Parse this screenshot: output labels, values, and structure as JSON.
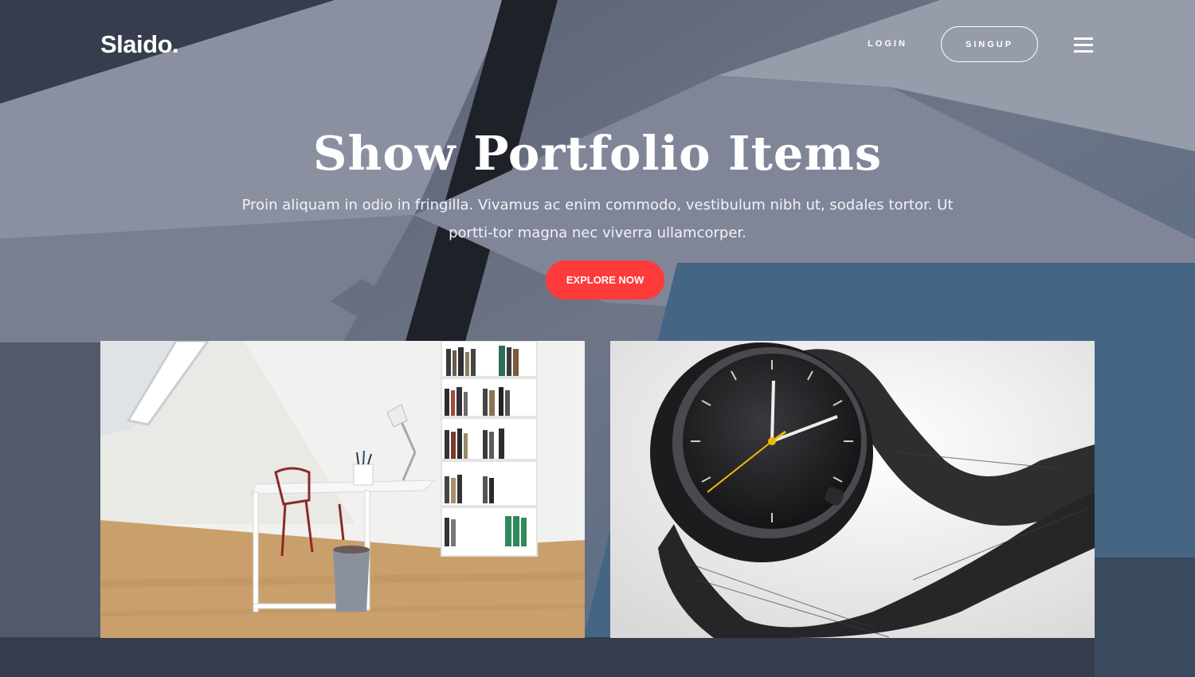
{
  "header": {
    "brand": "Slaido.",
    "login_label": "LOGIN",
    "signup_label": "SINGUP",
    "menu_icon": "hamburger-menu-icon"
  },
  "hero": {
    "title": "Show Portfolio Items",
    "description": "Proin aliquam in odio in fringilla. Vivamus ac enim commodo, vestibulum nibh ut, sodales tortor. Ut portti-tor magna nec viverra ullamcorper.",
    "cta_label": "EXPLORE NOW",
    "background_image": "architectural-frames-photo"
  },
  "portfolio": {
    "items": [
      {
        "image": "white-office-desk-with-bookshelf-photo"
      },
      {
        "image": "black-wristwatch-mesh-strap-photo"
      }
    ]
  },
  "colors": {
    "accent": "#ff3a3a",
    "text_on_dark": "#ffffff"
  }
}
